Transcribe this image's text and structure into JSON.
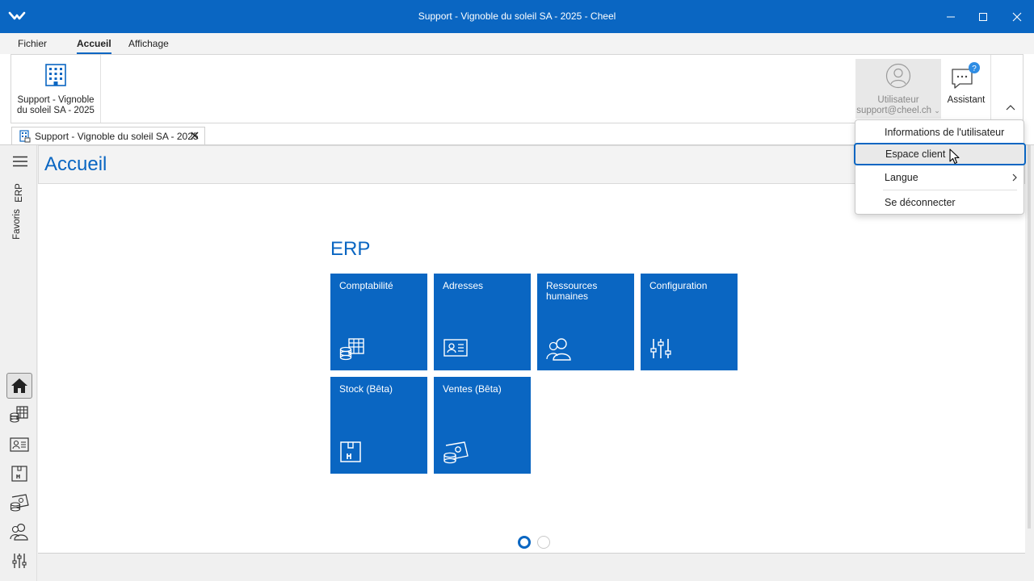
{
  "window": {
    "title": "Support - Vignoble du soleil SA - 2025 - Cheel",
    "accent": "#0a66c2"
  },
  "ribbon": {
    "tabs": [
      "Fichier",
      "Accueil",
      "Affichage"
    ],
    "active_tab": "Accueil",
    "company_label": "Support - Vignoble du soleil SA - 2025",
    "user_label": "Utilisateur",
    "user_email": "support@cheel.ch",
    "assistant_label": "Assistant"
  },
  "document_tab": {
    "label": "Support - Vignoble du soleil SA - 2025"
  },
  "sidebar": {
    "vertical_tabs": [
      "ERP",
      "Favoris"
    ],
    "nav_icons": [
      "home-icon",
      "accounting-icon",
      "address-card-icon",
      "stock-box-icon",
      "sales-icon",
      "people-icon",
      "sliders-icon"
    ]
  },
  "page": {
    "title": "Accueil",
    "section_title": "ERP",
    "tiles": [
      {
        "label": "Comptabilité",
        "icon": "accounting-icon"
      },
      {
        "label": "Adresses",
        "icon": "address-card-icon"
      },
      {
        "label": "Ressources humaines",
        "icon": "people-icon"
      },
      {
        "label": "Configuration",
        "icon": "sliders-icon"
      },
      {
        "label": "Stock (Bêta)",
        "icon": "stock-box-icon"
      },
      {
        "label": "Ventes (Bêta)",
        "icon": "sales-icon"
      }
    ],
    "pager": {
      "pages": 2,
      "current": 1
    }
  },
  "user_menu": {
    "items": [
      "Informations de l'utilisateur",
      "Espace client",
      "Langue",
      "Se déconnecter"
    ],
    "hovered": "Espace client"
  }
}
